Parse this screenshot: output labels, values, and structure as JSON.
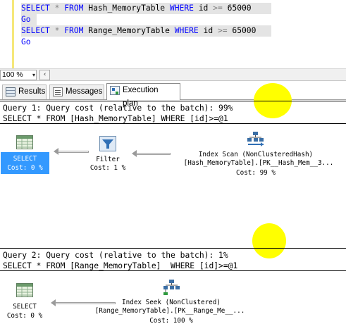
{
  "editor": {
    "lines": [
      {
        "kw1": "SELECT",
        "op": "*",
        "kw2": "FROM",
        "table": "Hash_MemoryTable",
        "kw3": "WHERE",
        "col": "id",
        "cmp": ">=",
        "val": "65000"
      },
      {
        "go": "Go"
      },
      {
        "kw1": "SELECT",
        "op": "*",
        "kw2": "FROM",
        "table": "Range_MemoryTable",
        "kw3": "WHERE",
        "col": "id",
        "cmp": ">=",
        "val": "65000"
      },
      {
        "go": "Go"
      }
    ]
  },
  "zoom": {
    "value": "100 %",
    "dropdown_glyph": "▾",
    "scroll_glyph": "‹"
  },
  "tabs": [
    {
      "label": "Results",
      "icon": "grid-icon"
    },
    {
      "label": "Messages",
      "icon": "messages-icon"
    },
    {
      "label": "Execution plan",
      "icon": "execution-plan-icon",
      "active": true
    }
  ],
  "query1": {
    "header": "Query 1: Query cost (relative to the batch): 99%",
    "sql": "SELECT * FROM [Hash_MemoryTable] WHERE [id]>=@1",
    "ops": {
      "select": {
        "name": "SELECT",
        "cost": "Cost: 0 %"
      },
      "filter": {
        "name": "Filter",
        "cost": "Cost: 1 %"
      },
      "scan": {
        "name": "Index Scan (NonClusteredHash)",
        "object": "[Hash_MemoryTable].[PK__Hash_Mem__3...",
        "cost": "Cost: 99 %"
      }
    }
  },
  "query2": {
    "header": "Query 2: Query cost (relative to the batch): 1%",
    "sql": "SELECT * FROM [Range_MemoryTable]  WHERE [id]>=@1",
    "ops": {
      "select": {
        "name": "SELECT",
        "cost": "Cost: 0 %"
      },
      "seek": {
        "name": "Index Seek (NonClustered)",
        "object": "[Range_MemoryTable].[PK__Range_Me__...",
        "cost": "Cost: 100 %"
      }
    }
  },
  "colors": {
    "keyword": "#0000ff",
    "operator": "#808080",
    "selection": "#3399ff",
    "highlight": "#ffff00"
  }
}
